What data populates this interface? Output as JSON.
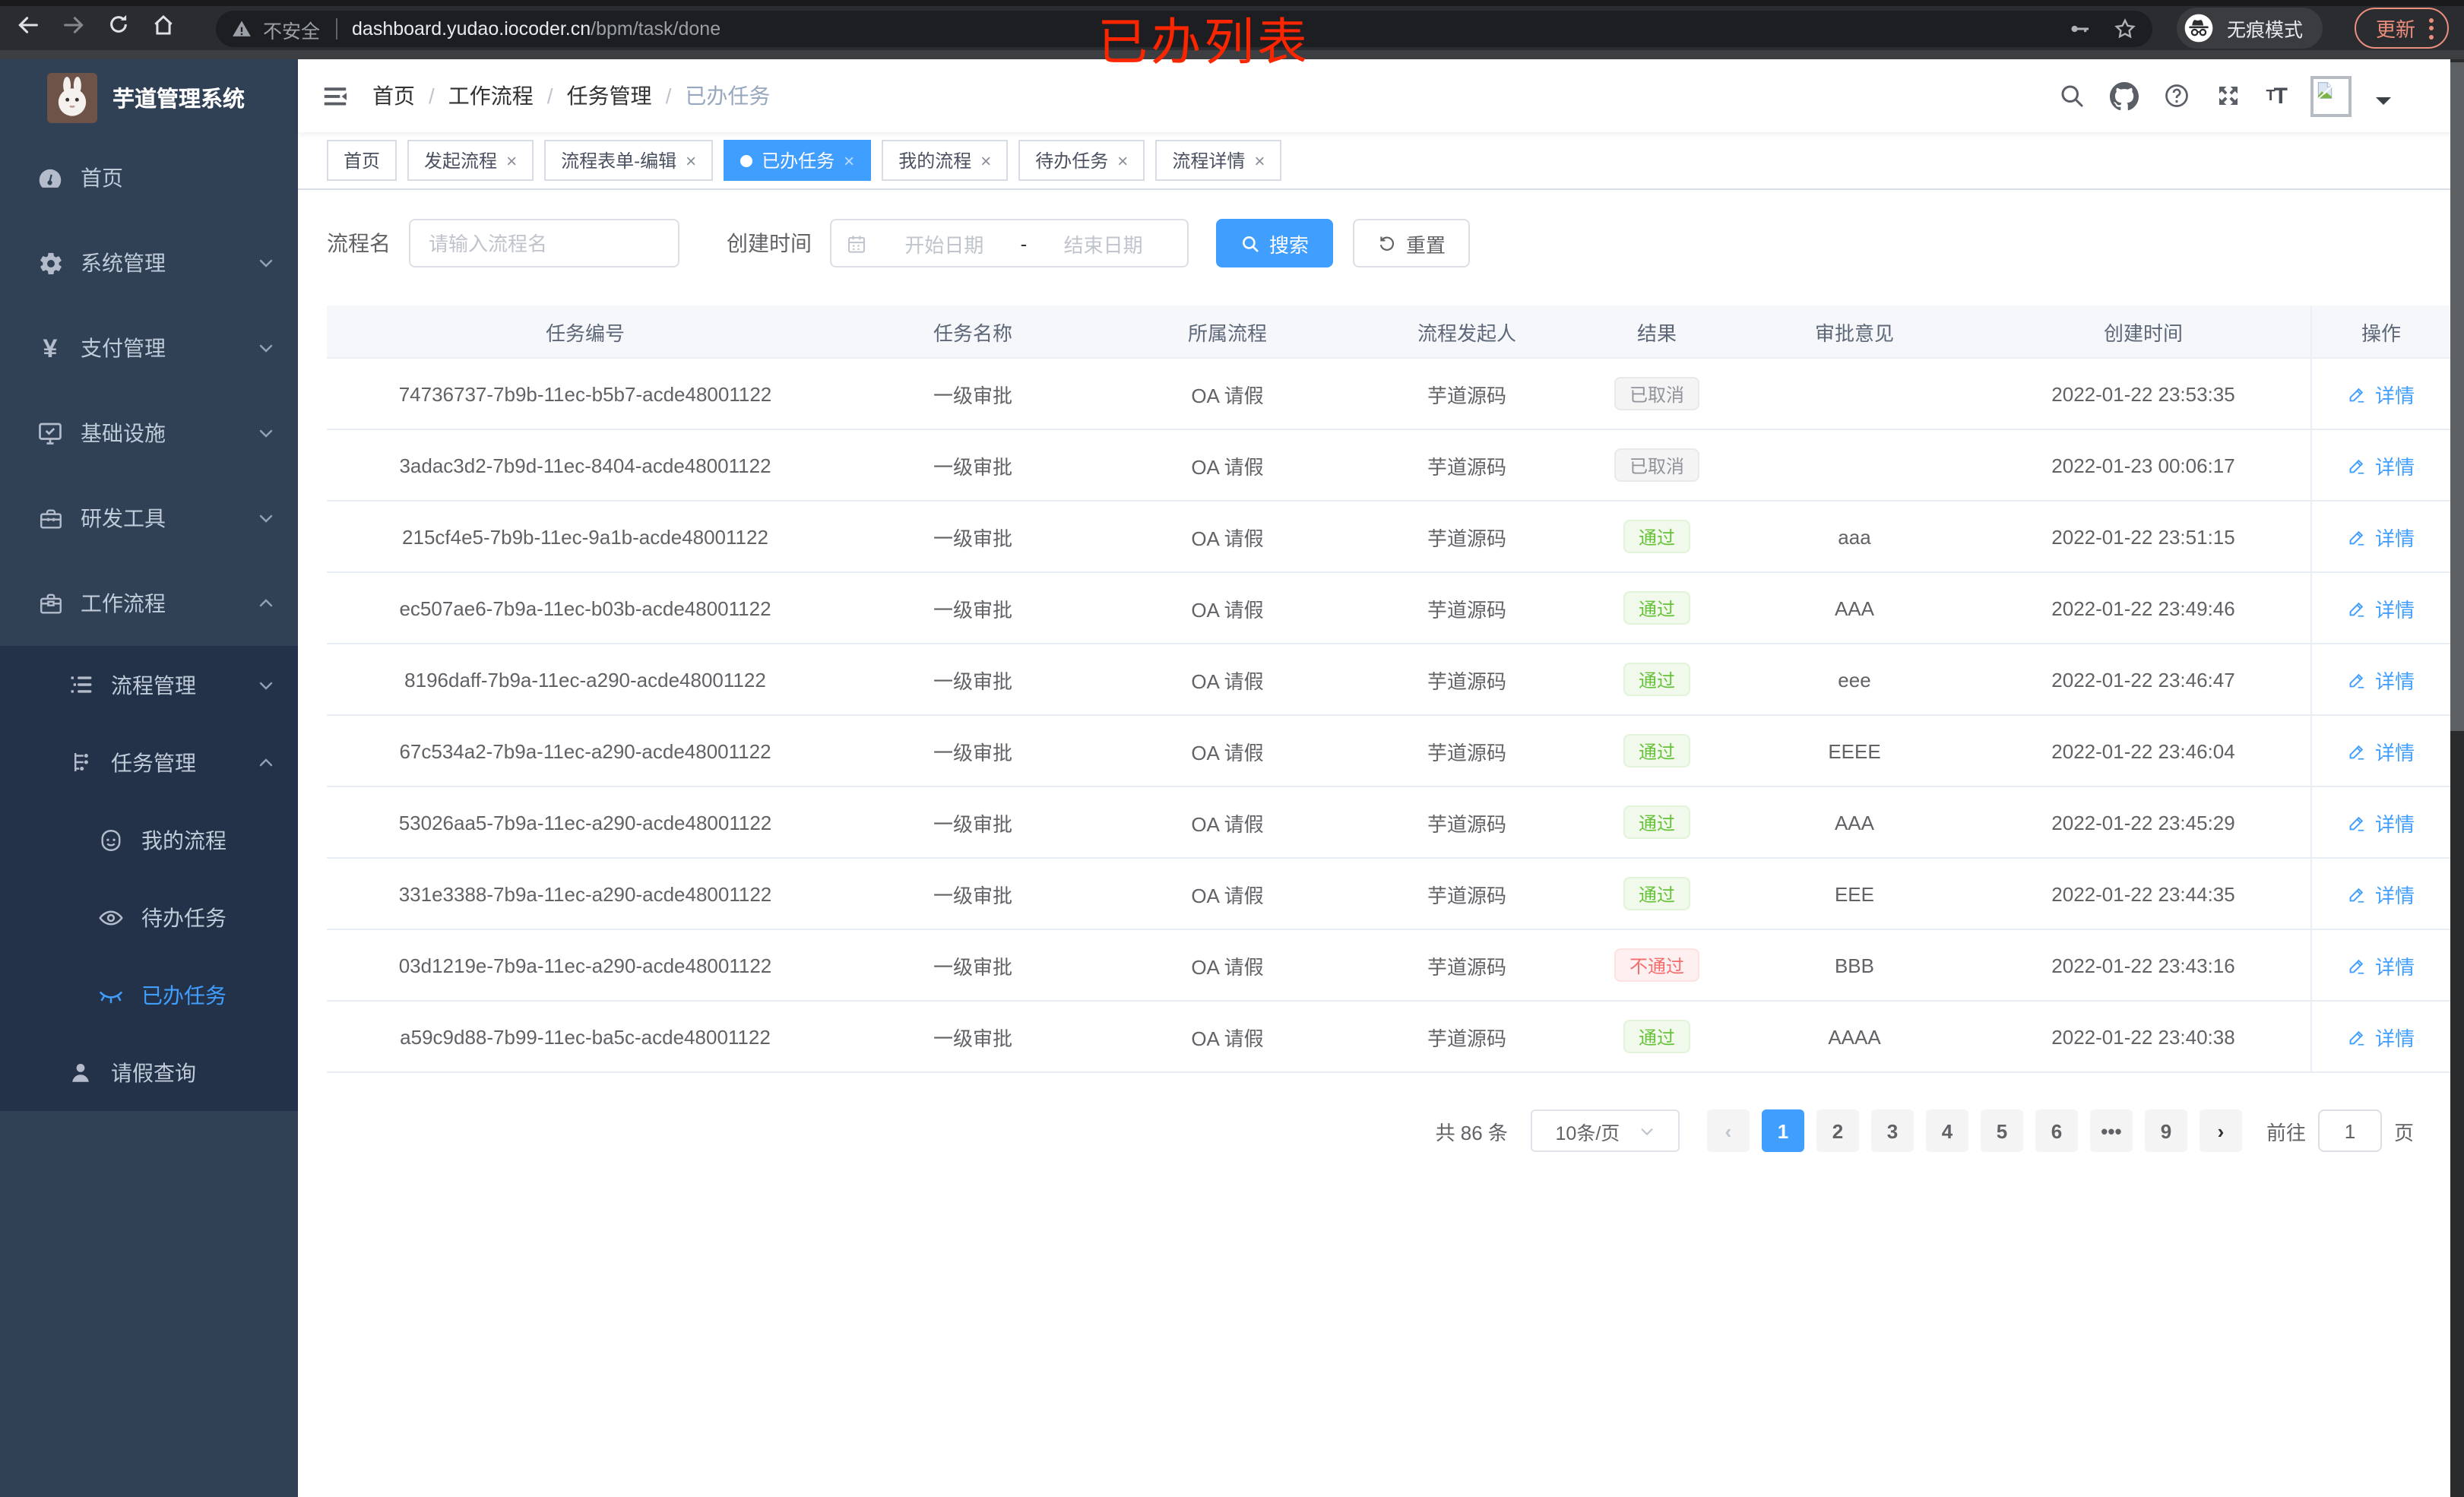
{
  "colors": {
    "accent": "#409eff",
    "success": "#67c23a",
    "danger": "#f56c6c",
    "info": "#909399",
    "sidebar_bg": "#304156",
    "submenu_bg": "#233248"
  },
  "annotation": {
    "text": "已办列表"
  },
  "browser": {
    "security_label": "不安全",
    "url_host": "dashboard.yudao.iocoder.cn",
    "url_path": "/bpm/task/done",
    "incognito_label": "无痕模式",
    "update_label": "更新"
  },
  "sidebar": {
    "logo_title": "芋道管理系统",
    "items": [
      {
        "label": "首页"
      },
      {
        "label": "系统管理"
      },
      {
        "label": "支付管理"
      },
      {
        "label": "基础设施"
      },
      {
        "label": "研发工具"
      },
      {
        "label": "工作流程"
      },
      {
        "label": "流程管理"
      },
      {
        "label": "任务管理"
      },
      {
        "label": "我的流程"
      },
      {
        "label": "待办任务"
      },
      {
        "label": "已办任务"
      },
      {
        "label": "请假查询"
      }
    ]
  },
  "breadcrumb": {
    "items": [
      "首页",
      "工作流程",
      "任务管理",
      "已办任务"
    ],
    "separator": "/"
  },
  "tabs": [
    {
      "label": "首页"
    },
    {
      "label": "发起流程"
    },
    {
      "label": "流程表单-编辑"
    },
    {
      "label": "已办任务"
    },
    {
      "label": "我的流程"
    },
    {
      "label": "待办任务"
    },
    {
      "label": "流程详情"
    }
  ],
  "filters": {
    "name_label": "流程名",
    "name_placeholder": "请输入流程名",
    "time_label": "创建时间",
    "start_placeholder": "开始日期",
    "range_separator": "-",
    "end_placeholder": "结束日期",
    "search_label": "搜索",
    "reset_label": "重置"
  },
  "table": {
    "headers": [
      "任务编号",
      "任务名称",
      "所属流程",
      "流程发起人",
      "结果",
      "审批意见",
      "创建时间",
      "操作"
    ],
    "detail_label": "详情",
    "rows": [
      {
        "id": "74736737-7b9b-11ec-b5b7-acde48001122",
        "name": "一级审批",
        "process": "OA 请假",
        "starter": "芋道源码",
        "result": "已取消",
        "result_type": "info",
        "comment": "",
        "time": "2022-01-22 23:53:35"
      },
      {
        "id": "3adac3d2-7b9d-11ec-8404-acde48001122",
        "name": "一级审批",
        "process": "OA 请假",
        "starter": "芋道源码",
        "result": "已取消",
        "result_type": "info",
        "comment": "",
        "time": "2022-01-23 00:06:17"
      },
      {
        "id": "215cf4e5-7b9b-11ec-9a1b-acde48001122",
        "name": "一级审批",
        "process": "OA 请假",
        "starter": "芋道源码",
        "result": "通过",
        "result_type": "success",
        "comment": "aaa",
        "time": "2022-01-22 23:51:15"
      },
      {
        "id": "ec507ae6-7b9a-11ec-b03b-acde48001122",
        "name": "一级审批",
        "process": "OA 请假",
        "starter": "芋道源码",
        "result": "通过",
        "result_type": "success",
        "comment": "AAA",
        "time": "2022-01-22 23:49:46"
      },
      {
        "id": "8196daff-7b9a-11ec-a290-acde48001122",
        "name": "一级审批",
        "process": "OA 请假",
        "starter": "芋道源码",
        "result": "通过",
        "result_type": "success",
        "comment": "eee",
        "time": "2022-01-22 23:46:47"
      },
      {
        "id": "67c534a2-7b9a-11ec-a290-acde48001122",
        "name": "一级审批",
        "process": "OA 请假",
        "starter": "芋道源码",
        "result": "通过",
        "result_type": "success",
        "comment": "EEEE",
        "time": "2022-01-22 23:46:04"
      },
      {
        "id": "53026aa5-7b9a-11ec-a290-acde48001122",
        "name": "一级审批",
        "process": "OA 请假",
        "starter": "芋道源码",
        "result": "通过",
        "result_type": "success",
        "comment": "AAA",
        "time": "2022-01-22 23:45:29"
      },
      {
        "id": "331e3388-7b9a-11ec-a290-acde48001122",
        "name": "一级审批",
        "process": "OA 请假",
        "starter": "芋道源码",
        "result": "通过",
        "result_type": "success",
        "comment": "EEE",
        "time": "2022-01-22 23:44:35"
      },
      {
        "id": "03d1219e-7b9a-11ec-a290-acde48001122",
        "name": "一级审批",
        "process": "OA 请假",
        "starter": "芋道源码",
        "result": "不通过",
        "result_type": "danger",
        "comment": "BBB",
        "time": "2022-01-22 23:43:16"
      },
      {
        "id": "a59c9d88-7b99-11ec-ba5c-acde48001122",
        "name": "一级审批",
        "process": "OA 请假",
        "starter": "芋道源码",
        "result": "通过",
        "result_type": "success",
        "comment": "AAAA",
        "time": "2022-01-22 23:40:38"
      }
    ]
  },
  "pagination": {
    "total_text": "共 86 条",
    "page_size": "10条/页",
    "pages": [
      "1",
      "2",
      "3",
      "4",
      "5",
      "6",
      "9"
    ],
    "ellipsis": "•••",
    "goto_label": "前往",
    "goto_value": "1",
    "page_label": "页"
  }
}
